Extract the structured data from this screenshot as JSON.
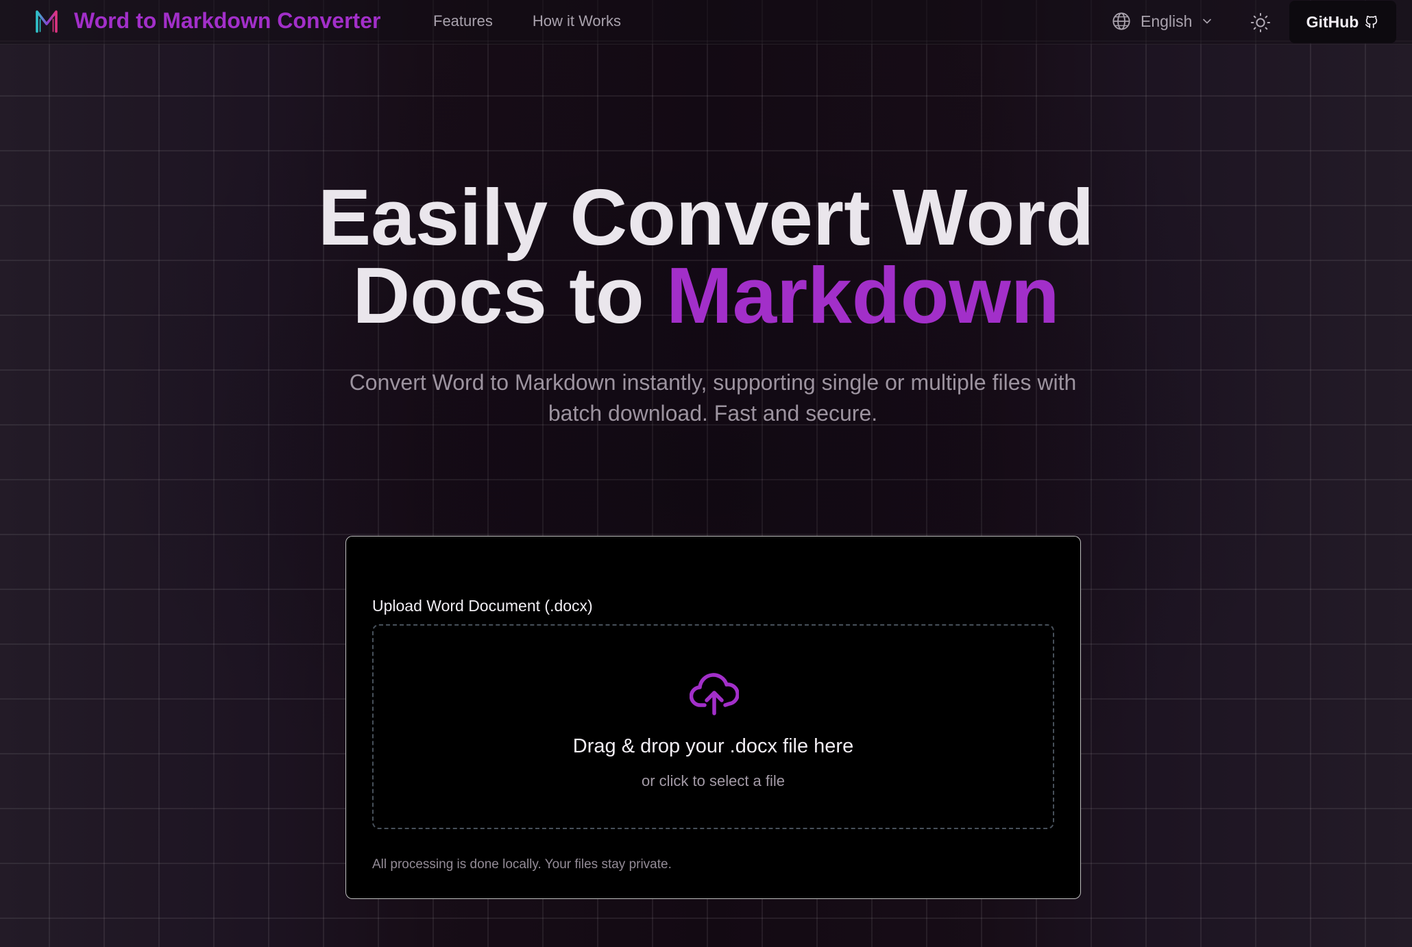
{
  "header": {
    "brand_title": "Word to Markdown Converter",
    "logo_icon": "markdown-m-logo",
    "nav": [
      {
        "label": "Features"
      },
      {
        "label": "How it Works"
      }
    ],
    "language": {
      "icon": "globe-icon",
      "selected": "English",
      "chevron_icon": "chevron-down-icon"
    },
    "theme_toggle_icon": "sun-icon",
    "github": {
      "label": "GitHub",
      "icon": "github-icon"
    }
  },
  "hero": {
    "title_line1": "Easily Convert Word",
    "title_line2_plain": "Docs to ",
    "title_line2_accent": "Markdown",
    "subtitle_line1": "Convert Word to Markdown instantly, supporting single or multiple files with",
    "subtitle_line2": "batch download. Fast and secure."
  },
  "upload": {
    "label": "Upload Word Document (.docx)",
    "icon": "cloud-upload-icon",
    "drop_title": "Drag & drop your .docx file here",
    "drop_sub": "or click to select a file",
    "privacy_note": "All processing is done locally. Your files stay private."
  },
  "colors": {
    "accent": "#a22fc9",
    "background": "#1a1220",
    "card": "#000000",
    "muted_text": "#9c939f",
    "logo_cyan": "#2ec4c9",
    "logo_pink": "#e0337e"
  }
}
